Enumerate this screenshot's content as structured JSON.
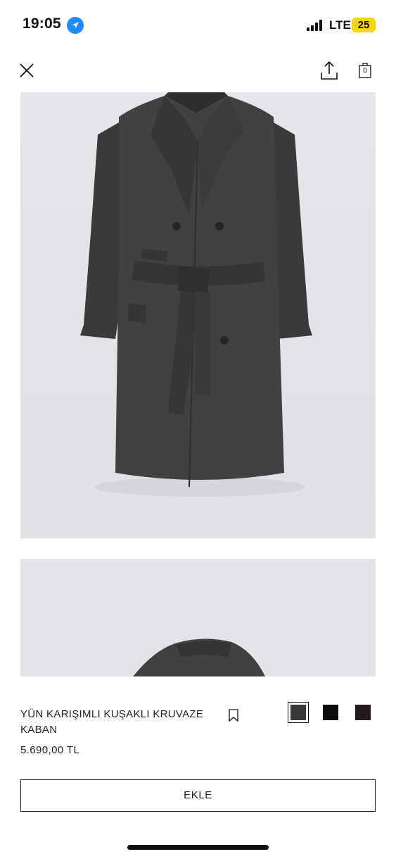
{
  "status_bar": {
    "time": "19:05",
    "network": "LTE",
    "battery": "25"
  },
  "header": {
    "icons": [
      "close-icon",
      "share-icon",
      "shopping-bag-icon"
    ],
    "cart_count": "0"
  },
  "gallery": {
    "images": [
      "coat-front-image",
      "coat-detail-image"
    ]
  },
  "product": {
    "title": "YÜN KARIŞIMLI KUŞAKLI KRUVAZE KABAN",
    "price": "5.690,00 TL",
    "colors": [
      "#3a3a3c",
      "#0b0b0b",
      "#22191a"
    ],
    "selected_color_index": 0
  },
  "actions": {
    "add_label": "EKLE"
  }
}
